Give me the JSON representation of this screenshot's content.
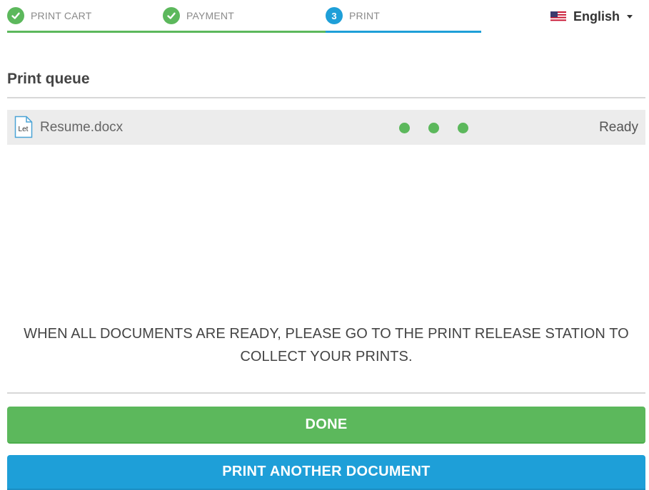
{
  "stepper": {
    "steps": [
      {
        "label": "PRINT CART",
        "state": "done"
      },
      {
        "label": "PAYMENT",
        "state": "done"
      },
      {
        "label": "PRINT",
        "number": "3",
        "state": "active"
      }
    ]
  },
  "language": {
    "label": "English",
    "flag": "us-flag-icon"
  },
  "queue": {
    "title": "Print queue",
    "items": [
      {
        "icon_text": "Let",
        "name": "Resume.docx",
        "status": "Ready",
        "progress_dots": 3
      }
    ]
  },
  "message": "WHEN ALL DOCUMENTS ARE READY, PLEASE GO TO THE PRINT RELEASE STATION TO COLLECT YOUR PRINTS.",
  "buttons": {
    "done": "DONE",
    "print_another": "PRINT ANOTHER DOCUMENT"
  },
  "colors": {
    "success": "#5cb85c",
    "primary": "#1e9fd8"
  }
}
